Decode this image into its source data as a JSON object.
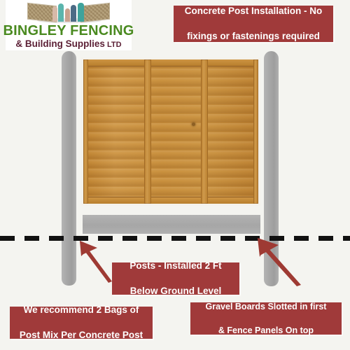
{
  "page": {
    "background_color": "#f4f4f0",
    "title": "Concrete Post Fence Installation Diagram"
  },
  "logo": {
    "name": "bingley-fencing-logo",
    "line1": "BINGLEY FENCING",
    "line2": "& Building Supplies",
    "suffix": "LTD",
    "line1_color": "#4a8a20",
    "line2_color": "#5c2036",
    "background": "#ffffff"
  },
  "callouts": {
    "color": "#a03a3a",
    "text_color": "#ffffff",
    "top": {
      "name": "callout-concrete-post-installation",
      "line1": "Concrete Post Installation - No",
      "line2": "fixings or fastenings required",
      "full": "Concrete Post Installation - No fixings or fastenings required"
    },
    "posts": {
      "name": "callout-posts-depth",
      "line1": "Posts - Installed 2 Ft",
      "line2": "Below Ground Level",
      "full": "Posts - Installed 2 Ft Below Ground Level"
    },
    "postmix": {
      "name": "callout-post-mix-recommendation",
      "line1": "We recommend 2 Bags of",
      "line2": "Post Mix Per Concrete Post",
      "full": "We recommend 2 Bags of Post Mix Per Concrete Post"
    },
    "gravel": {
      "name": "callout-gravel-boards-order",
      "line1": "Gravel Boards Slotted in first",
      "line2": "& Fence Panels On top",
      "full": "Gravel Boards Slotted in first & Fence Panels On top"
    }
  },
  "diagram": {
    "posts": {
      "label": "concrete-post",
      "color": "#a8a8a8",
      "count": 2
    },
    "panel": {
      "label": "overlap-fence-panel",
      "color": "#c58a3d",
      "frame_color": "#f4f2ec",
      "batten_count": 4
    },
    "gravel_board": {
      "label": "concrete-gravel-board",
      "color": "#ababab"
    },
    "ground_line": {
      "label": "ground-level-line",
      "color": "#111111",
      "style": "dashed"
    },
    "arrows": {
      "color": "#9e3a33",
      "count": 2
    }
  }
}
